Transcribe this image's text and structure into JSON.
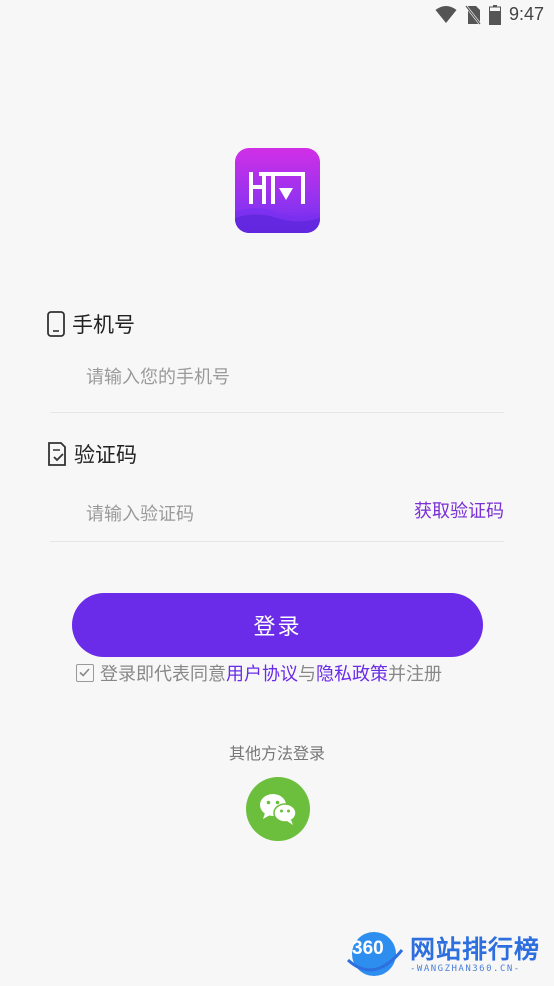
{
  "status_bar": {
    "time": "9:47",
    "icons": [
      "wifi-icon",
      "no-sim-icon",
      "battery-icon"
    ]
  },
  "app": {
    "logo_icon": "app-logo-icon",
    "brand_gradient": [
      "#d12fe6",
      "#6a2bea"
    ]
  },
  "phone_field": {
    "label": "手机号",
    "icon": "phone-icon",
    "placeholder": "请输入您的手机号",
    "value": ""
  },
  "code_field": {
    "label": "验证码",
    "icon": "verify-code-icon",
    "placeholder": "请输入验证码",
    "value": "",
    "get_code_label": "获取验证码"
  },
  "login_button": {
    "label": "登录",
    "color": "#6a2ce8"
  },
  "agreement": {
    "checked": true,
    "prefix": "登录即代表同意",
    "user_agreement": "用户协议",
    "conjunction": "与",
    "privacy_policy": "隐私政策",
    "suffix": "并注册"
  },
  "other_login": {
    "label": "其他方法登录",
    "wechat_icon": "wechat-icon",
    "wechat_color": "#6cbf3c"
  },
  "watermark": {
    "badge": "360",
    "title": "网站排行榜",
    "subtitle": "-WANGZHAN360.CN-"
  }
}
